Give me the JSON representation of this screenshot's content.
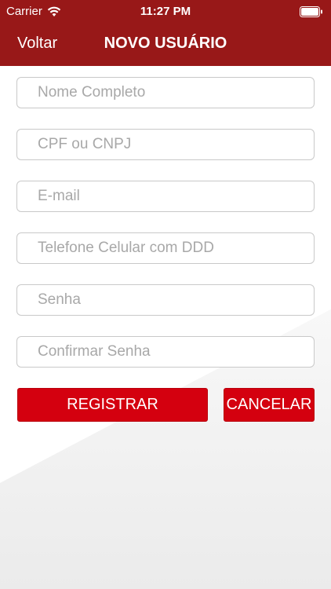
{
  "status_bar": {
    "carrier": "Carrier",
    "time": "11:27 PM"
  },
  "nav": {
    "back_label": "Voltar",
    "title": "NOVO USUÁRIO"
  },
  "form": {
    "fields": [
      {
        "placeholder": "Nome Completo",
        "value": ""
      },
      {
        "placeholder": "CPF ou CNPJ",
        "value": ""
      },
      {
        "placeholder": "E-mail",
        "value": ""
      },
      {
        "placeholder": "Telefone Celular com DDD",
        "value": ""
      },
      {
        "placeholder": "Senha",
        "value": ""
      },
      {
        "placeholder": "Confirmar Senha",
        "value": ""
      }
    ],
    "register_label": "REGISTRAR",
    "cancel_label": "CANCELAR"
  },
  "colors": {
    "header": "#981818",
    "button": "#d4000f"
  }
}
